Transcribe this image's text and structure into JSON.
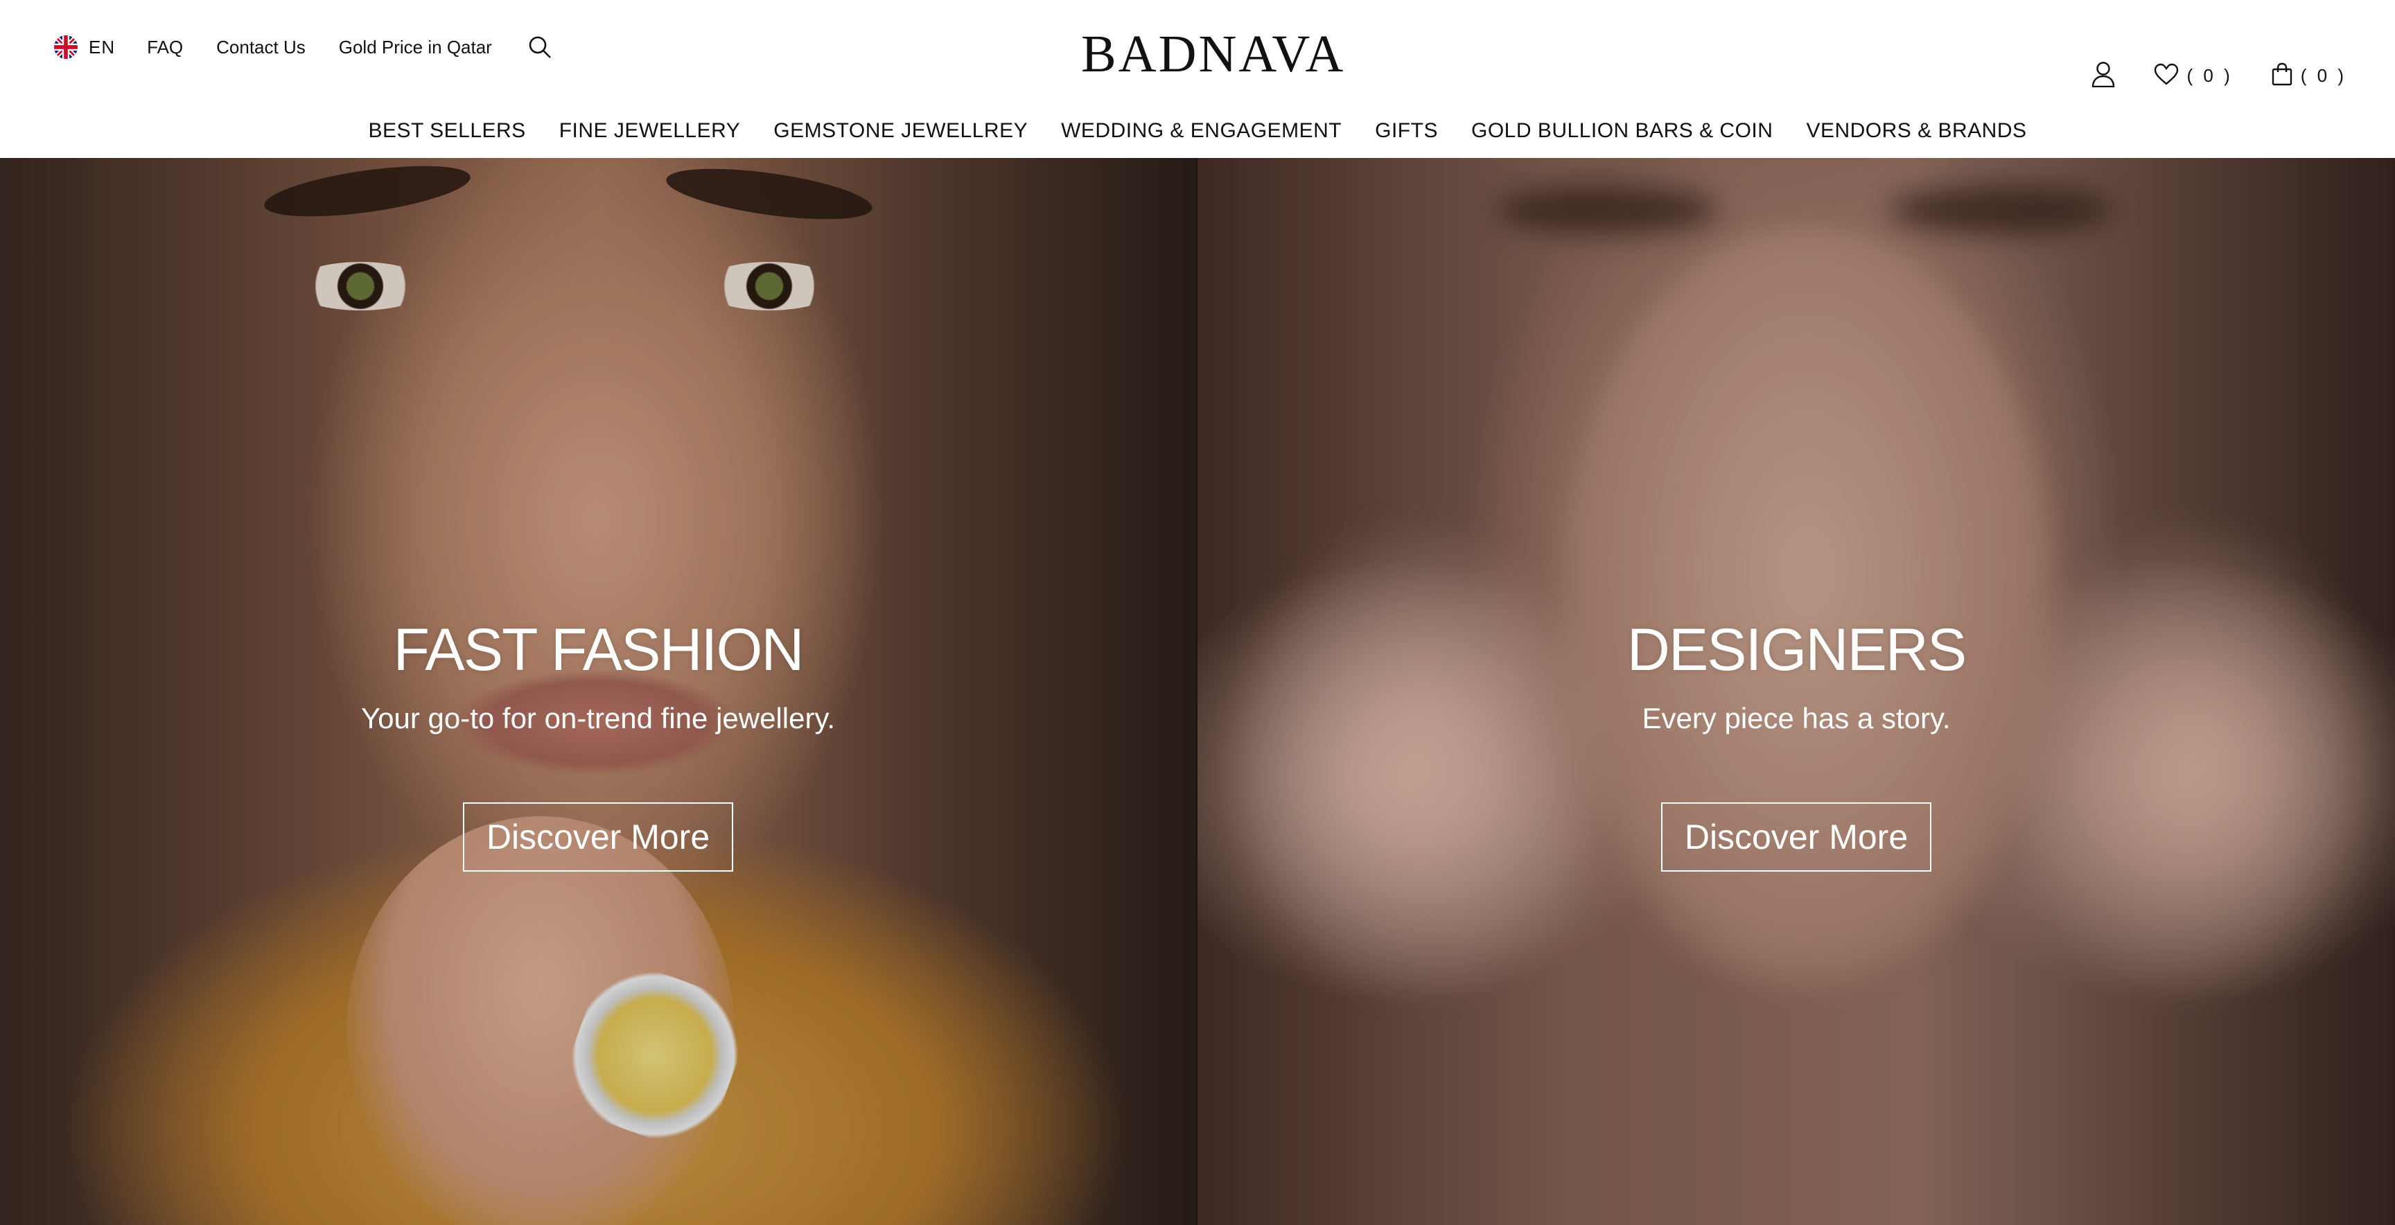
{
  "header": {
    "language": {
      "code": "EN",
      "flag_icon": "uk-flag-icon"
    },
    "util_links": [
      "FAQ",
      "Contact Us",
      "Gold Price in Qatar"
    ],
    "search_icon": "search-icon",
    "logo": "BADNAVA",
    "actions": {
      "account_icon": "user-icon",
      "wishlist_icon": "heart-icon",
      "wishlist_count": "( 0 )",
      "bag_icon": "shopping-bag-icon",
      "bag_count": "( 0 )"
    },
    "nav": [
      "BEST SELLERS",
      "FINE JEWELLERY",
      "GEMSTONE JEWELLREY",
      "WEDDING & ENGAGEMENT",
      "GIFTS",
      "GOLD BULLION BARS & COIN",
      "VENDORS & BRANDS"
    ]
  },
  "hero": {
    "panels": [
      {
        "title": "FAST FASHION",
        "subtitle": "Your go-to for on-trend fine jewellery.",
        "button": "Discover More"
      },
      {
        "title": "DESIGNERS",
        "subtitle": "Every piece has a story.",
        "button": "Discover More"
      }
    ]
  },
  "colors": {
    "text": "#111111",
    "background": "#ffffff",
    "hero_text": "#ffffff"
  }
}
